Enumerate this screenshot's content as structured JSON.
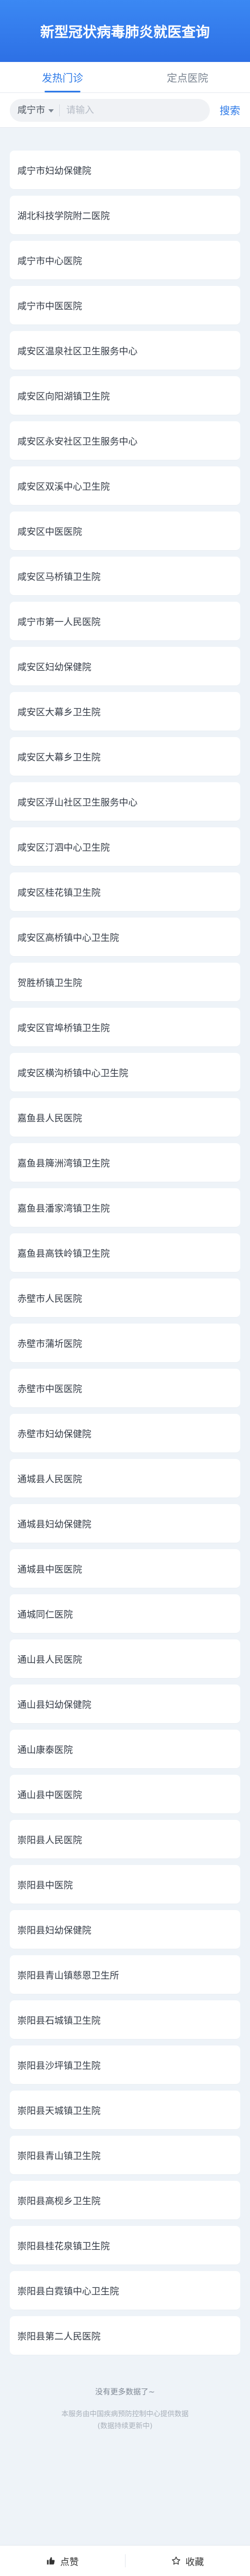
{
  "page": {
    "title": "新型冠状病毒肺炎就医查询"
  },
  "tabs": [
    {
      "label": "发热门诊"
    },
    {
      "label": "定点医院"
    }
  ],
  "search": {
    "city": "咸宁市",
    "placeholder": "请输入",
    "button": "搜索"
  },
  "hospitals": [
    "咸宁市妇幼保健院",
    "湖北科技学院附二医院",
    "咸宁市中心医院",
    "咸宁市中医医院",
    "咸安区温泉社区卫生服务中心",
    "咸安区向阳湖镇卫生院",
    "咸安区永安社区卫生服务中心",
    "咸安区双溪中心卫生院",
    "咸安区中医医院",
    "咸安区马桥镇卫生院",
    "咸宁市第一人民医院",
    "咸安区妇幼保健院",
    "咸安区大幕乡卫生院",
    "咸安区大幕乡卫生院",
    "咸安区浮山社区卫生服务中心",
    "咸安区汀泗中心卫生院",
    "咸安区桂花镇卫生院",
    "咸安区高桥镇中心卫生院",
    "贺胜桥镇卫生院",
    "咸安区官埠桥镇卫生院",
    "咸安区横沟桥镇中心卫生院",
    "嘉鱼县人民医院",
    "嘉鱼县簰洲湾镇卫生院",
    "嘉鱼县潘家湾镇卫生院",
    "嘉鱼县高铁岭镇卫生院",
    "赤壁市人民医院",
    "赤壁市蒲圻医院",
    "赤壁市中医医院",
    "赤壁市妇幼保健院",
    "通城县人民医院",
    "通城县妇幼保健院",
    "通城县中医医院",
    "通城同仁医院",
    "通山县人民医院",
    "通山县妇幼保健院",
    "通山康泰医院",
    "通山县中医医院",
    "崇阳县人民医院",
    "崇阳县中医院",
    "崇阳县妇幼保健院",
    "崇阳县青山镇慈恩卫生所",
    "崇阳县石城镇卫生院",
    "崇阳县沙坪镇卫生院",
    "崇阳县天城镇卫生院",
    "崇阳县青山镇卫生院",
    "崇阳县高枧乡卫生院",
    "崇阳县桂花泉镇卫生院",
    "崇阳县白霓镇中心卫生院",
    "崇阳县第二人民医院"
  ],
  "footer": {
    "no_more": "没有更多数据了~",
    "source_line1": "本服务由中国疾病预防控制中心提供数据",
    "source_line2": "(数据持续更新中)"
  },
  "actions": {
    "like": "点赞",
    "favorite": "收藏"
  },
  "colors": {
    "primary": "#2f7be8",
    "background": "#eef3f8"
  }
}
